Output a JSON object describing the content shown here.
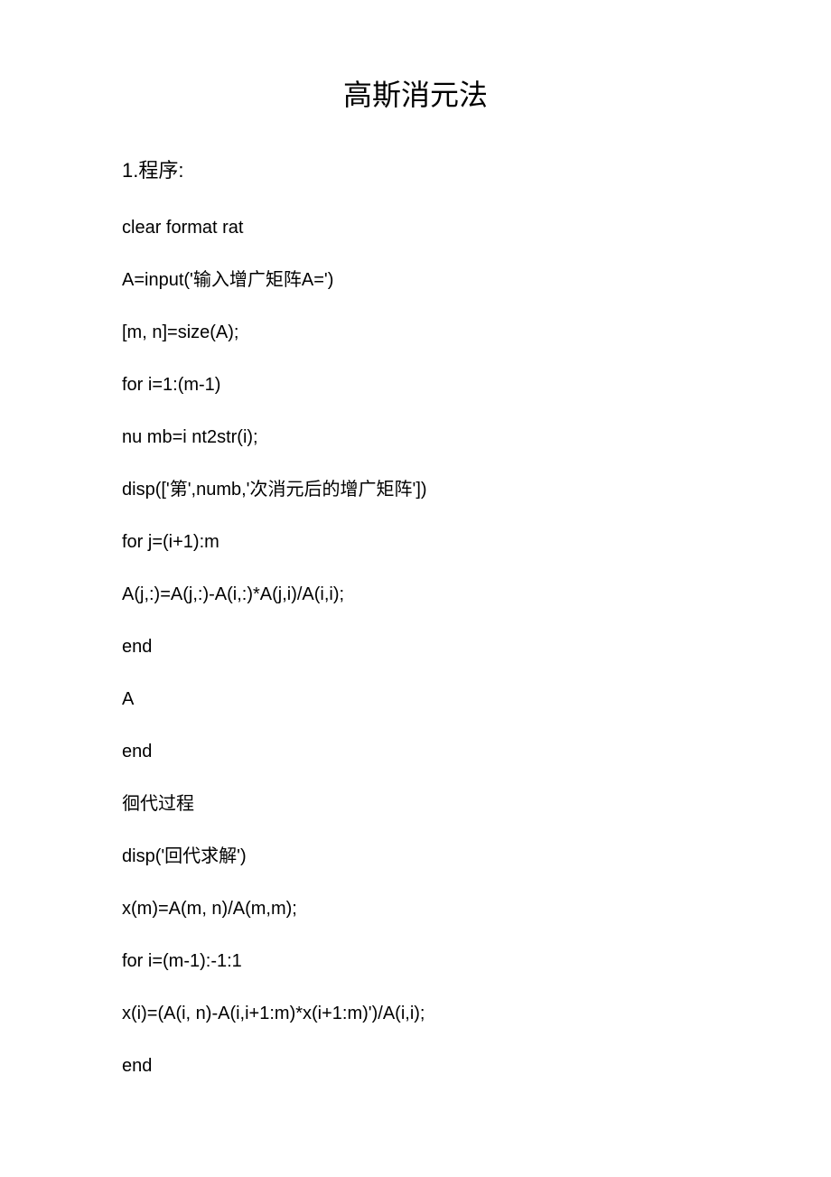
{
  "title": "高斯消元法",
  "section_header": "1.程序:",
  "lines": [
    "clear format rat",
    "A=input('输入增广矩阵A=')",
    "[m, n]=size(A);",
    "for i=1:(m-1)",
    "nu mb=i nt2str(i);",
    "disp(['第',numb,'次消元后的增广矩阵'])",
    "for j=(i+1):m",
    "A(j,:)=A(j,:)-A(i,:)*A(j,i)/A(i,i);",
    "end",
    "A",
    "end",
    "徊代过程",
    "disp('回代求解')",
    "x(m)=A(m, n)/A(m,m);",
    "for i=(m-1):-1:1",
    "x(i)=(A(i, n)-A(i,i+1:m)*x(i+1:m)')/A(i,i);",
    "end"
  ]
}
